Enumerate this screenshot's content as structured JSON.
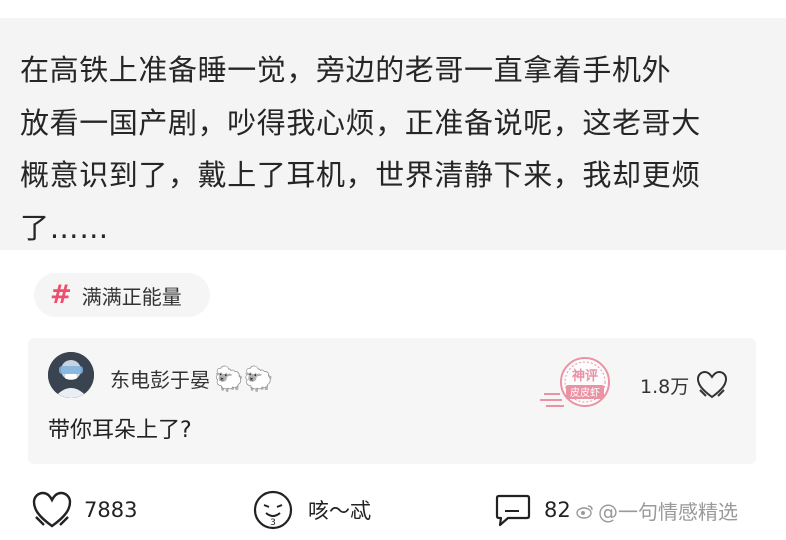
{
  "post": {
    "text": "在高铁上准备睡一觉，旁边的老哥一直拿着手机外\n放看一国产剧，吵得我心烦，正准备说呢，这老哥大\n概意识到了，戴上了耳机，世界清静下来，我却更烦\n了……"
  },
  "topic": {
    "hash_icon": "hashtag-icon",
    "label": "满满正能量"
  },
  "comment": {
    "author": "东电彭于晏",
    "author_badges": "🐑🐑",
    "text": "带你耳朵上了?",
    "like_count": "1.8万",
    "stamp_top": "神评",
    "stamp_bottom": "皮皮虾"
  },
  "actions": {
    "like_count": "7883",
    "reaction_label": "咳～忒",
    "comment_count": "82"
  },
  "watermark": {
    "text": "@一句情感精选"
  },
  "colors": {
    "accent": "#ee4e6b",
    "stamp": "#e8718a",
    "post_bg": "#f4f4f4"
  }
}
